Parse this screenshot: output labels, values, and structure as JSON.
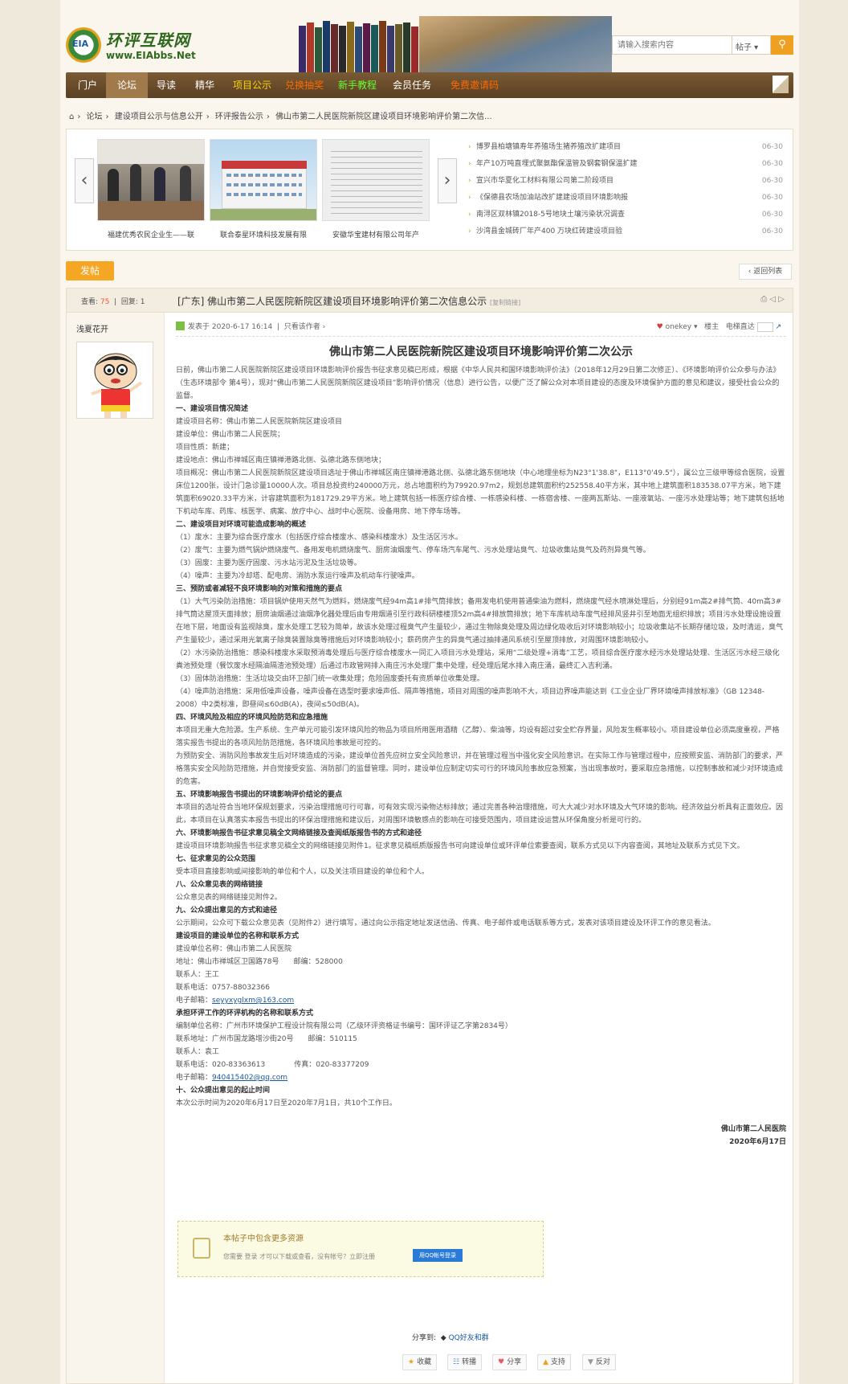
{
  "site": {
    "logo_badge": "EIA",
    "logo_cn": "环评互联网",
    "logo_url": "www.EIAbbs.Net"
  },
  "search": {
    "placeholder": "请输入搜索内容",
    "type": "帖子",
    "button_icon": "search-icon"
  },
  "nav": [
    "门户",
    "论坛",
    "导读",
    "精华",
    "项目公示",
    "兑换抽奖",
    "新手教程",
    "会员任务",
    "免费邀请码"
  ],
  "breadcrumb": [
    "论坛",
    "建设项目公示与信息公开",
    "环评报告公示",
    "佛山市第二人民医院新院区建设项目环境影响评价第二次信..."
  ],
  "slider": {
    "captions": [
      "福建优秀农民企业生——联",
      "联合泰星环境科技发展有限",
      "安徽华宝建材有限公司年产"
    ],
    "news": [
      {
        "t": "博罗县柏塘镇寿年养殖场生猪养殖改扩建项目",
        "d": "06-30"
      },
      {
        "t": "年产10万吨直埋式聚氨酯保温管及钢套钢保温扩建",
        "d": "06-30"
      },
      {
        "t": "宣兴市华夏化工材料有限公司第二阶段项目",
        "d": "06-30"
      },
      {
        "t": "《保德县农场加油站改扩建建设项目环境影响报",
        "d": "06-30"
      },
      {
        "t": "南浔区双林镇2018-5号地块土壤污染状况调查",
        "d": "06-30"
      },
      {
        "t": "沙湾县金城砖厂年产400 万块红砖建设项目验",
        "d": "06-30"
      }
    ]
  },
  "post_btn": "发帖",
  "back_btn": "‹ 返回列表",
  "thread": {
    "views_label": "查看:",
    "views": "75",
    "replies_label": "回复:",
    "replies": "1",
    "title": "[广东] 佛山市第二人民医院新院区建设项目环境影响评价第二次信息公示",
    "title_extra": "[复制链接]",
    "author": "浅夏花开",
    "posted": "发表于 2020-6-17 16:14",
    "only_author": "只看该作者 ›",
    "meta_user": "onekey",
    "meta_floor": "楼主",
    "meta_jump": "电梯直达"
  },
  "article": {
    "title": "佛山市第二人民医院新院区建设项目环境影响评价第二次公示",
    "paras": [
      {
        "h": false,
        "t": "日前，佛山市第二人民医院新院区建设项目环境影响评价报告书征求意见稿已形成，根据《中华人民共和国环境影响评价法》（2018年12月29日第二次修正）、《环境影响评价公众参与办法》（生态环境部令 第4号），现对“佛山市第二人民医院新院区建设项目”影响评价情况（信息）进行公告，以便广泛了解公众对本项目建设的态度及环境保护方面的意见和建议，接受社会公众的监督。"
      },
      {
        "h": true,
        "t": "一、建设项目情况简述"
      },
      {
        "h": false,
        "t": "建设项目名称：佛山市第二人民医院新院区建设项目"
      },
      {
        "h": false,
        "t": "建设单位：佛山市第二人民医院；"
      },
      {
        "h": false,
        "t": "项目性质：新建；"
      },
      {
        "h": false,
        "t": "建设地点：佛山市禅城区南庄镇禅港路北侧、弘德北路东侧地块；"
      },
      {
        "h": false,
        "t": "项目概况：佛山市第二人民医院新院区建设项目选址于佛山市禅城区南庄镇禅港路北侧、弘德北路东侧地块（中心地理坐标为N23°1'38.8\"，E113°0'49.5\"），属公立三级甲等综合医院，设置床位1200张，设计门急诊量10000人次。项目总投资约240000万元，总占地面积约为79920.97m2，规划总建筑面积约252558.40平方米，其中地上建筑面积183538.07平方米，地下建筑面积69020.33平方米，计容建筑面积为181729.29平方米。地上建筑包括一栋医疗综合楼、一栋感染科楼、一栋宿舍楼、一座两瓦斯站、一座液氧站、一座污水处理站等；地下建筑包括地下机动车库、药库、核医学、病案、放疗中心、战时中心医院、设备用房、地下停车场等。"
      },
      {
        "h": true,
        "t": "二、建设项目对环境可能造成影响的概述"
      },
      {
        "h": false,
        "t": "（1）废水：主要为综合医疗废水（包括医疗综合楼废水、感染科楼废水）及生活区污水。"
      },
      {
        "h": false,
        "t": "（2）废气：主要为燃气锅炉燃烧废气、备用发电机燃烧废气、厨房油烟废气、停车场汽车尾气、污水处理站臭气、垃圾收集站臭气及药剂异臭气等。"
      },
      {
        "h": false,
        "t": "（3）固废：主要为医疗固废、污水站污泥及生活垃圾等。"
      },
      {
        "h": false,
        "t": "（4）噪声：主要为冷却塔、配电房、消防水泵运行噪声及机动车行驶噪声。"
      },
      {
        "h": true,
        "t": "三、预防或者减轻不良环境影响的对策和措施的要点"
      },
      {
        "h": false,
        "t": "（1）大气污染防治措施：项目锅炉使用天然气为燃料，燃烧废气经94m高1#排气筒排放；备用发电机使用普通柴油为燃料，燃烧废气经水喷淋处理后，分别经91m高2#排气筒、40m高3#排气筒达屋顶天面排放；厨房油烟通过油烟净化器处理后由专用烟道引至行政科研楼楼顶52m高4#排放筒排放；地下车库机动车废气经排风竖井引至地面无组织排放；项目污水处理设施设置在地下层，地面设有监视除臭，废水处理工艺较为简单，故该水处理过程臭气产生量较少，通过生物除臭处理及周边绿化吸收后对环境影响较小；垃圾收集站不长期存储垃圾，及时清运，臭气产生量较少，通过采用光氧离子除臭装置除臭等措施后对环境影响较小；薪药房产生的异臭气通过抽排通风系统引至屋顶排放，对周围环境影响较小。"
      },
      {
        "h": false,
        "t": "（2）水污染防治措施：感染科楼废水采取预消毒处理后与医疗综合楼废水一同汇入项目污水处理站，采用“二级处理+消毒”工艺，项目综合医疗废水经污水处理站处理、生活区污水经三级化粪池预处理（餐饮废水经隔油隔渣池预处理）后通过市政管网排入南庄污水处理厂集中处理，经处理后尾水排入南庄涌，最终汇入吉利涌。"
      },
      {
        "h": false,
        "t": "（3）固体防治措施：生活垃圾交由环卫部门统一收集处理；危险固废委托有资质单位收集处理。"
      },
      {
        "h": false,
        "t": "（4）噪声防治措施：采用低噪声设备，噪声设备在选型时要求噪声低、隔声等措施，项目对周围的噪声影响不大，项目边界噪声能达到《工业企业厂界环境噪声排放标准》（GB 12348-2008）中2类标准，即昼间≤60dB(A)，夜间≤50dB(A)。"
      },
      {
        "h": true,
        "t": "四、环境风险及相应的环境风险防范和应急措施"
      },
      {
        "h": false,
        "t": "本项目无重大危险源。生产系统、生产单元可能引发环境风险的物品为项目所用医用酒精（乙醇）、柴油等，均设有超过安全贮存界量，风险发生概率较小。项目建设单位必须高度重视，严格落实报告书提出的各项风险防范措施，各环境风险事故是可控的。"
      },
      {
        "h": false,
        "t": "为预防安全、消防风险事故发生后对环境造成的污染，建设单位首先应树立安全风险意识，并在管理过程当中强化安全风险意识。在实际工作与管理过程中，应按照安监、消防部门的要求，严格落实安全风险防范措施，并自觉接受安监、消防部门的监督管理。同时，建设单位应制定切实可行的环境风险事故应急预案，当出现事故时，要采取应急措施，以控制事故和减少对环境造成的危害。"
      },
      {
        "h": true,
        "t": "五、环境影响报告书提出的环境影响评价结论的要点"
      },
      {
        "h": false,
        "t": "本项目的选址符合当地环保规划要求，污染治理措施可行可靠，可有效实现污染物达标排放；通过完善各种治理措施，可大大减少对水环境及大气环境的影响。经济效益分析具有正面效应。因此，本项目在认真落实本报告书提出的环保治理措施和建议后，对周围环境敏感点的影响在可接受范围内，项目建设运营从环保角度分析是可行的。"
      },
      {
        "h": true,
        "t": "六、环境影响报告书征求意见稿全文网络链接及查阅纸版报告书的方式和途径"
      },
      {
        "h": false,
        "t": "建设项目环境影响报告书征求意见稿全文的网络链接见附件1。征求意见稿纸质版报告书可向建设单位或环评单位索要查阅，联系方式见以下内容查阅，其地址及联系方式见下文。"
      },
      {
        "h": true,
        "t": "七、征求意见的公众范围"
      },
      {
        "h": false,
        "t": "受本项目直接影响或间接影响的单位和个人，以及关注项目建设的单位和个人。"
      },
      {
        "h": true,
        "t": "八、公众意见表的网络链接"
      },
      {
        "h": false,
        "t": "公众意见表的网络链接见附件2。"
      },
      {
        "h": true,
        "t": "九、公众提出意见的方式和途径"
      },
      {
        "h": false,
        "t": "公示期间，公众可下载公众意见表（见附件2）进行填写，通过向公示指定地址发送信函、传真、电子邮件或电话联系等方式，发表对该项目建设及环评工作的意见看法。"
      },
      {
        "h": true,
        "t": "建设项目的建设单位的名称和联系方式"
      },
      {
        "h": false,
        "t": "建设单位名称：佛山市第二人民医院"
      },
      {
        "h": false,
        "t": "地址：佛山市禅城区卫国路78号　　邮编：528000"
      },
      {
        "h": false,
        "t": "联系人：王工"
      },
      {
        "h": false,
        "t": "联系电话：0757-88032366"
      },
      {
        "h": false,
        "t": "电子邮箱：",
        "link": "seyyxyglxm@163.com"
      },
      {
        "h": true,
        "t": "承担环评工作的环评机构的名称和联系方式"
      },
      {
        "h": false,
        "t": "编制单位名称：广州市环境保护工程设计院有限公司（乙级环评资格证书编号：国环评证乙字第2834号）"
      },
      {
        "h": false,
        "t": "联系地址：广州市国龙路增沙街20号　　邮编：510115"
      },
      {
        "h": false,
        "t": "联系人：袁工"
      },
      {
        "h": false,
        "t": "联系电话：020-83363613　　　　传真：020-83377209"
      },
      {
        "h": false,
        "t": "电子邮箱：",
        "link": "940415402@qq.com"
      },
      {
        "h": true,
        "t": "十、公众提出意见的起止时间"
      },
      {
        "h": false,
        "t": "本次公示时间为2020年6月17日至2020年7月1日，共10个工作日。"
      }
    ],
    "sign_org": "佛山市第二人民医院",
    "sign_date": "2020年6月17日"
  },
  "hidebox": {
    "title": "本帖子中包含更多资源",
    "sub": "您需要 登录 才可以下载或查看，没有帐号？立即注册",
    "qq_btn": "用QQ帐号登录"
  },
  "share": {
    "label": "分享到:",
    "qq": "QQ好友和群"
  },
  "actions": [
    "收藏",
    "转播",
    "分享",
    "支持",
    "反对"
  ]
}
